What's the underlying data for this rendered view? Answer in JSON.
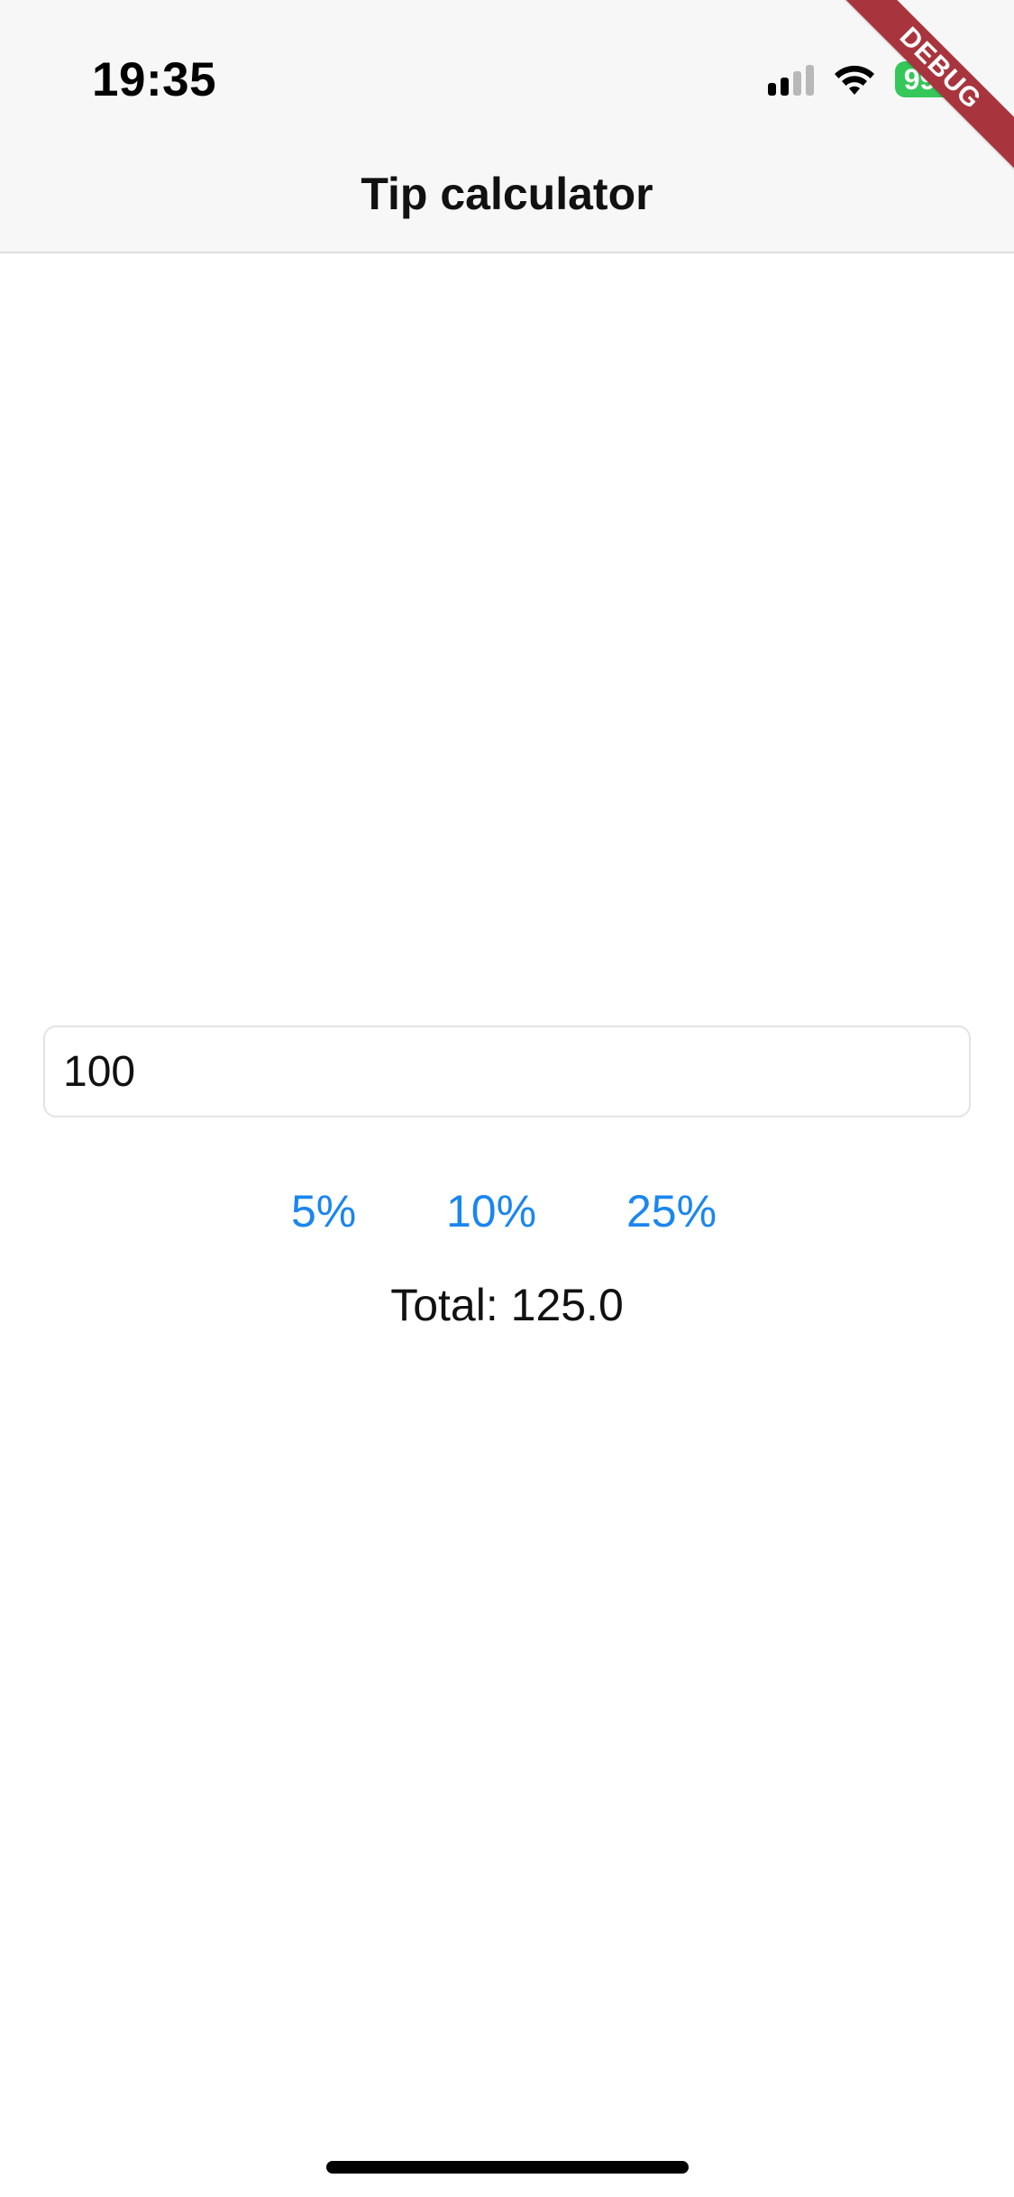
{
  "status_bar": {
    "time": "19:35",
    "battery_level": "99",
    "signal_bars_active": 2,
    "signal_bars_total": 4,
    "icons": [
      "cellular-signal-icon",
      "wifi-icon",
      "battery-charging-icon"
    ]
  },
  "debug_banner": {
    "label": "DEBUG"
  },
  "nav": {
    "title": "Tip calculator"
  },
  "form": {
    "amount_value": "100",
    "tip_options": [
      {
        "label": "5%"
      },
      {
        "label": "10%"
      },
      {
        "label": "25%"
      }
    ],
    "total_text": "Total: 125.0"
  },
  "colors": {
    "accent": "#1a86f0",
    "battery": "#34c759",
    "nav_background": "#f7f7f7",
    "debug_ribbon": "#a8353d"
  }
}
